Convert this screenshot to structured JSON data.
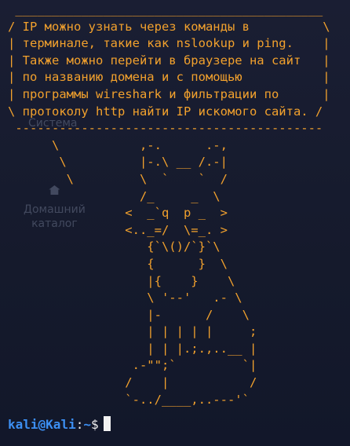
{
  "desktop": {
    "system_icon_label": "Система",
    "home_icon_label": "Домашний\nкаталог"
  },
  "terminal": {
    "cowsay_text": " __________________________________________\n/ IP можно узнать через команды в          \\\n| терминале, такие как nslookup и ping.    |\n| Также можно перейти в браузере на сайт   |\n| по названию домена и с помощью           |\n| программы wireshark и фильтрации по      |\n\\ протоколу http найти IP искомого сайта. /\n ------------------------------------------\n      \\           ,-.      .-,\n       \\          |-.\\ __ /.-|\n        \\         \\  `    `  /\n                  /_     _  \\\n                <  _`q  p _  >\n                <.._=/  \\=_. >\n                   {`\\()/`}`\\\n                   {      }  \\\n                   |{    }    \\\n                   \\ '--'   .- \\\n                   |-      /    \\\n                   | | | | |     ;\n                   | | |.;.,..__ |\n                 .-\"\";`         `|\n                /    |           /\n                `-../____,..---'`",
    "prompt": {
      "user": "kali",
      "at": "@",
      "host": "Kali",
      "sep": ":",
      "path": "~",
      "sign": "$"
    }
  },
  "colors": {
    "background": "#161a2e",
    "cowsay_text": "#f2a12d",
    "prompt_blue": "#3c8ff2",
    "prompt_white": "#f0f0f0"
  }
}
